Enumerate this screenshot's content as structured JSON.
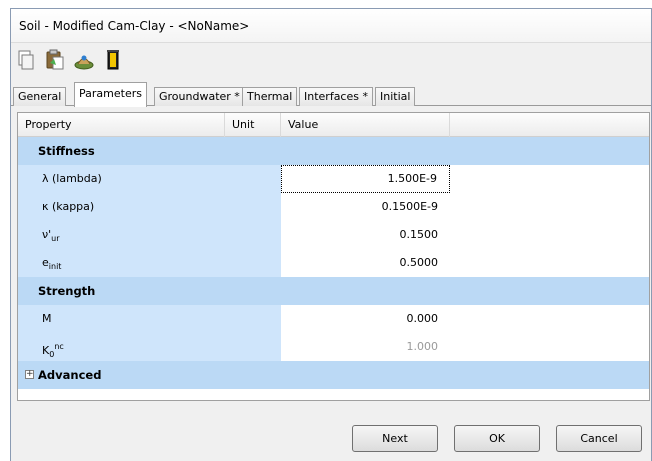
{
  "window": {
    "title": "Soil - Modified Cam-Clay - <NoName>"
  },
  "toolbar": {
    "buttons": [
      "copy-document-icon",
      "paste-document-icon",
      "soil-sample-icon",
      "battery-chart-icon"
    ]
  },
  "tabs": [
    {
      "label": "General"
    },
    {
      "label": "Parameters",
      "active": true
    },
    {
      "label": "Groundwater *"
    },
    {
      "label": "Thermal"
    },
    {
      "label": "Interfaces *"
    },
    {
      "label": "Initial"
    }
  ],
  "table": {
    "headers": {
      "property": "Property",
      "unit": "Unit",
      "value": "Value"
    },
    "groups": {
      "stiffness": "Stiffness",
      "strength": "Strength",
      "advanced": "Advanced"
    },
    "rows": {
      "lambda": {
        "label": "λ (lambda)",
        "value": "1.500E-9"
      },
      "kappa": {
        "label": "κ (kappa)",
        "value": "0.1500E-9"
      },
      "nu_ur": {
        "main": "ν'",
        "sub": "ur",
        "value": "0.1500"
      },
      "e_init": {
        "main": "e",
        "sub": "init",
        "value": "0.5000"
      },
      "M": {
        "label": "M",
        "value": "0.000"
      },
      "K0nc": {
        "main": "K",
        "sub": "0",
        "sup": "nc",
        "value": "1.000"
      }
    }
  },
  "footer": {
    "next": "Next",
    "ok": "OK",
    "cancel": "Cancel"
  },
  "colors": {
    "group_bg": "#bbd9f5",
    "row_bg": "#cfe5fb",
    "window_bg": "#f0f0f0"
  }
}
